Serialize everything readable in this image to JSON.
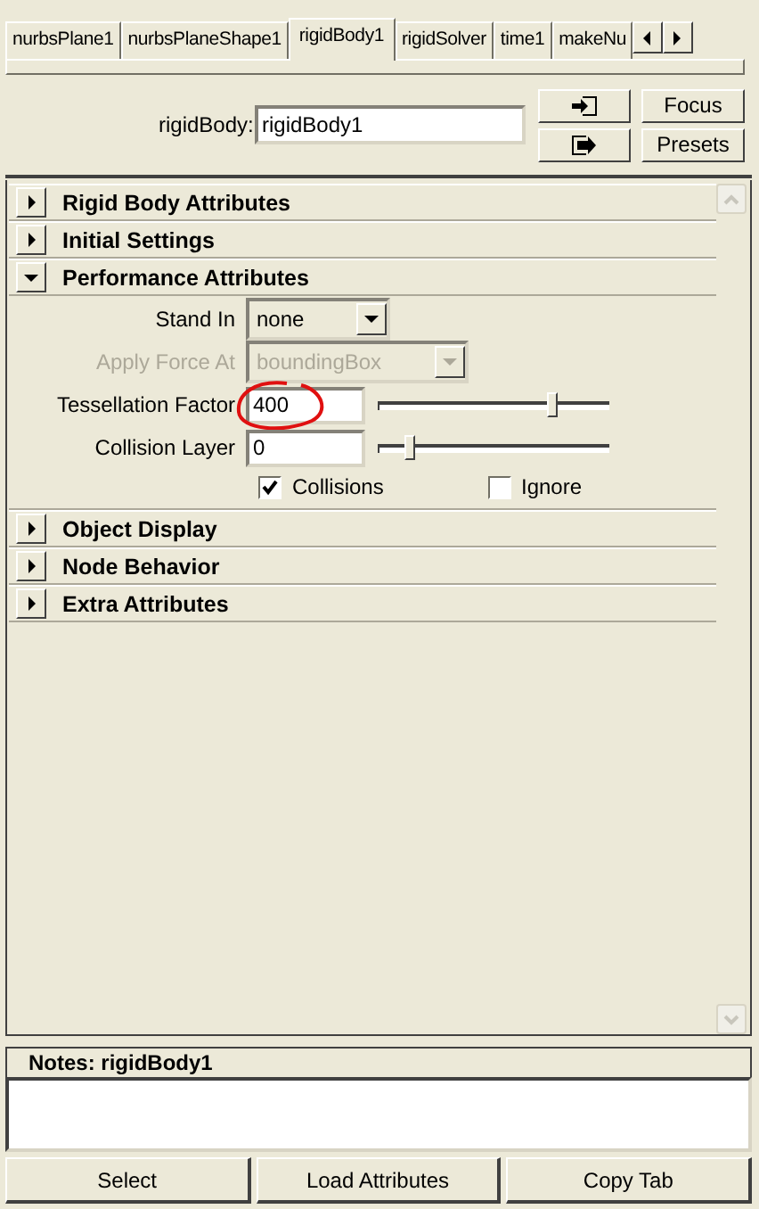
{
  "tabs": [
    {
      "label": "nurbsPlane1",
      "selected": false
    },
    {
      "label": "nurbsPlaneShape1",
      "selected": false
    },
    {
      "label": "rigidBody1",
      "selected": true
    },
    {
      "label": "rigidSolver",
      "selected": false
    },
    {
      "label": "time1",
      "selected": false
    },
    {
      "label": "makeNu",
      "selected": false
    }
  ],
  "node": {
    "label": "rigidBody:",
    "value": "rigidBody1"
  },
  "header_buttons": [
    "Focus",
    "Presets"
  ],
  "sections": [
    {
      "title": "Rigid Body Attributes",
      "expanded": false
    },
    {
      "title": "Initial Settings",
      "expanded": false
    },
    {
      "title": "Performance Attributes",
      "expanded": true,
      "attributes": [
        {
          "kind": "dropdown",
          "label": "Stand In",
          "value": "none",
          "disabled": false
        },
        {
          "kind": "dropdown",
          "label": "Apply Force At",
          "value": "boundingBox",
          "disabled": true
        },
        {
          "kind": "slider",
          "label": "Tessellation Factor",
          "value": "400",
          "level": 0.78,
          "circled": true
        },
        {
          "kind": "slider",
          "label": "Collision Layer",
          "value": "0",
          "level": 0.12
        },
        {
          "kind": "checkboxes",
          "items": [
            {
              "label": "Collisions",
              "checked": true
            },
            {
              "label": "Ignore",
              "checked": false
            }
          ]
        }
      ]
    },
    {
      "title": "Object Display",
      "expanded": false
    },
    {
      "title": "Node Behavior",
      "expanded": false
    },
    {
      "title": "Extra Attributes",
      "expanded": false
    }
  ],
  "notes": {
    "title": "Notes: rigidBody1"
  },
  "buttons": [
    "Select",
    "Load Attributes",
    "Copy Tab"
  ]
}
